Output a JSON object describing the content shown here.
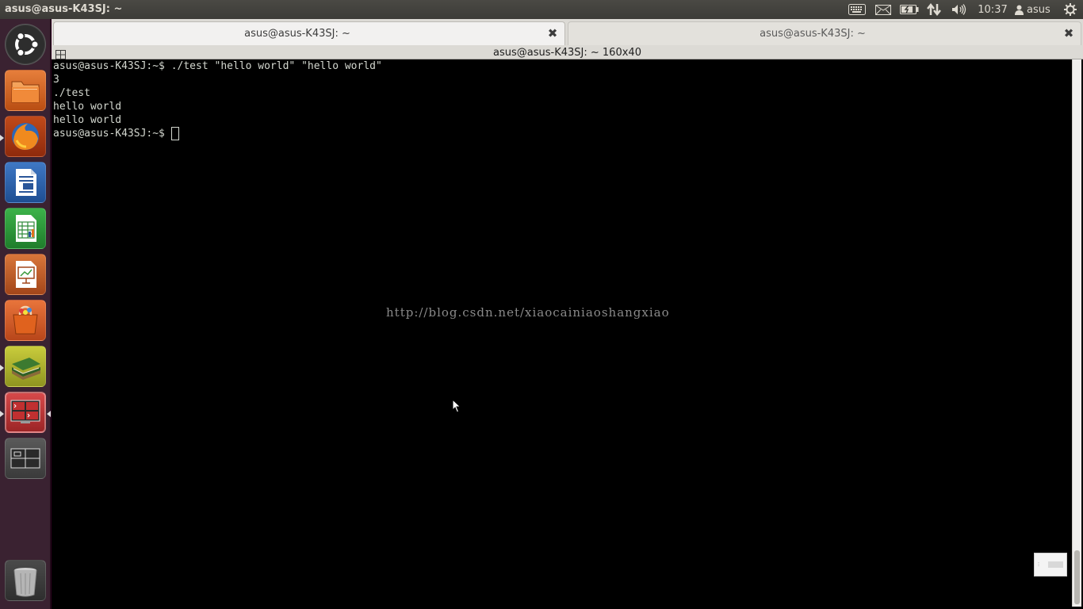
{
  "top_panel": {
    "window_title": "asus@asus-K43SJ: ~",
    "clock": "10:37",
    "user_name": "asus",
    "icons": [
      "keyboard-icon",
      "mail-icon",
      "battery-icon",
      "network-icon",
      "volume-icon",
      "user-icon",
      "power-icon"
    ]
  },
  "launcher": {
    "items": [
      "ubuntu-dash",
      "files",
      "firefox",
      "libreoffice-writer",
      "libreoffice-calc",
      "libreoffice-impress",
      "software-center",
      "book-reader",
      "terminal",
      "workspace-switcher",
      "trash"
    ]
  },
  "terminal_window": {
    "tabs": [
      {
        "label": "asus@asus-K43SJ: ~",
        "active": true
      },
      {
        "label": "asus@asus-K43SJ: ~",
        "active": false
      }
    ],
    "title": "asus@asus-K43SJ: ~ 160x40",
    "lines": [
      "asus@asus-K43SJ:~$ ./test \"hello world\" \"hello world\"",
      "3",
      "./test",
      "hello world",
      "hello world"
    ],
    "prompt": "asus@asus-K43SJ:~$ "
  },
  "watermark": "http://blog.csdn.net/xiaocainiaoshangxiao",
  "colors": {
    "launcher_bg": "#3a2231",
    "panel_bg": "#3c3b37",
    "terminal_bg": "#000000",
    "terminal_fg": "#d3d7cf"
  }
}
